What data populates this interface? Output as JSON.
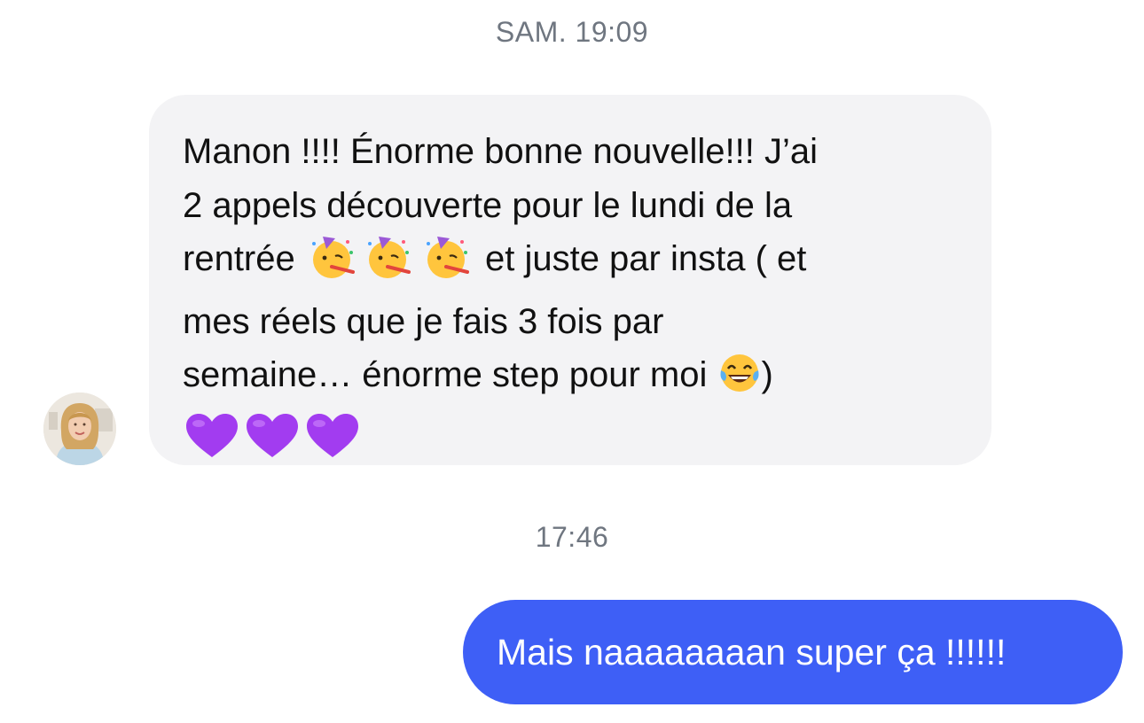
{
  "conversation": {
    "timestamp_1": "SAM. 19:09",
    "incoming_message": {
      "line1": "Manon !!!! Énorme bonne nouvelle!!! J’ai",
      "line2": "2 appels découverte pour le lundi de la",
      "line3_before_emoji": "rentrée ",
      "line3_after_emoji": " et juste par insta ( et",
      "line4": "mes réels que je fais 3 fois par",
      "line5_before_emoji": "semaine… énorme step pour moi ",
      "line5_after_emoji": ")",
      "emojis_line3": [
        "partying-face-icon",
        "partying-face-icon",
        "partying-face-icon"
      ],
      "emoji_line5": "tears-of-joy-icon",
      "emojis_line6": [
        "purple-heart-icon",
        "purple-heart-icon",
        "purple-heart-icon"
      ]
    },
    "timestamp_2": "17:46",
    "outgoing_message": "Mais naaaaaaaan super ça !!!!!!"
  },
  "colors": {
    "incoming_bubble": "#f3f3f5",
    "outgoing_bubble": "#3e5ff6",
    "timestamp_text": "#6f7680",
    "purple_heart": "#a23cf0"
  }
}
